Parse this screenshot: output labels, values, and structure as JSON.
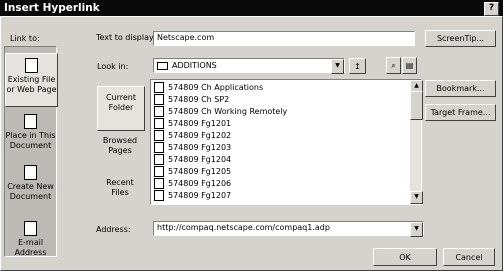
{
  "dialog": {
    "title": "Insert Hyperlink",
    "help_label": "?"
  },
  "link_to": {
    "label": "Link to:",
    "items": [
      {
        "label": "Existing File or Web Page"
      },
      {
        "label": "Place in This Document"
      },
      {
        "label": "Create New Document"
      },
      {
        "label": "E-mail Address"
      }
    ]
  },
  "display": {
    "label": "Text to display:",
    "value": "Netscape.com"
  },
  "screentip_button": "ScreenTip...",
  "look_in": {
    "label": "Look in:",
    "value": "ADDITIONS"
  },
  "locations": [
    {
      "label": "Current Folder"
    },
    {
      "label": "Browsed Pages"
    },
    {
      "label": "Recent Files"
    }
  ],
  "files": [
    "574809 Ch Applications",
    "574809 Ch SP2",
    "574809 Ch Working Remotely",
    "574809 Fg1201",
    "574809 Fg1202",
    "574809 Fg1203",
    "574809 Fg1204",
    "574809 Fg1205",
    "574809 Fg1206",
    "574809 Fg1207"
  ],
  "bookmark_button": "Bookmark...",
  "target_frame_button": "Target Frame...",
  "address": {
    "label": "Address:",
    "value": "http://compaq.netscape.com/compaq1.adp"
  },
  "ok_button": "OK",
  "cancel_button": "Cancel"
}
